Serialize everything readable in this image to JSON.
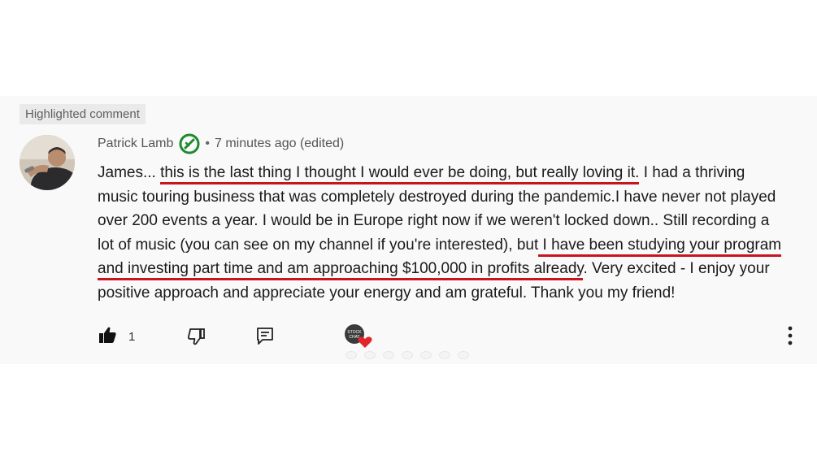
{
  "badge": {
    "label": "Highlighted comment"
  },
  "comment": {
    "author": "Patrick Lamb",
    "separator": "•",
    "timestamp": "7 minutes ago (edited)",
    "lines": {
      "l1_pre": "James... ",
      "l1_ul": "this is the last thing I thought I would ever be doing, but really loving it.",
      "l1_post": " I had a thriving",
      "l2": "music touring business that was completely destroyed during the pandemic.I have never not played",
      "l3": "over 200 events a year. I would be in Europe right now if we weren't locked down.. Still recording a",
      "l4_pre": "lot of music (you can see on my channel if you're interested), but",
      "l4_ul": " I have been studying your program",
      "l5_ul": "and investing part time and am approaching $100,000  in profits already",
      "l5_post": ". Very excited - I enjoy your",
      "l6": "positive approach and appreciate your energy and am grateful. Thank you my friend!"
    }
  },
  "actions": {
    "like_count": "1",
    "hearted_badge_text": "STOCK CHAT"
  },
  "colors": {
    "underline": "#c8141e",
    "verified_green": "#1e8a2f",
    "heart": "#e0262b"
  },
  "icons": {
    "like": "thumbs-up-icon",
    "dislike": "thumbs-down-icon",
    "reply": "reply-icon",
    "verified": "verified-badge-icon",
    "more": "more-vertical-icon",
    "heart": "heart-icon"
  }
}
